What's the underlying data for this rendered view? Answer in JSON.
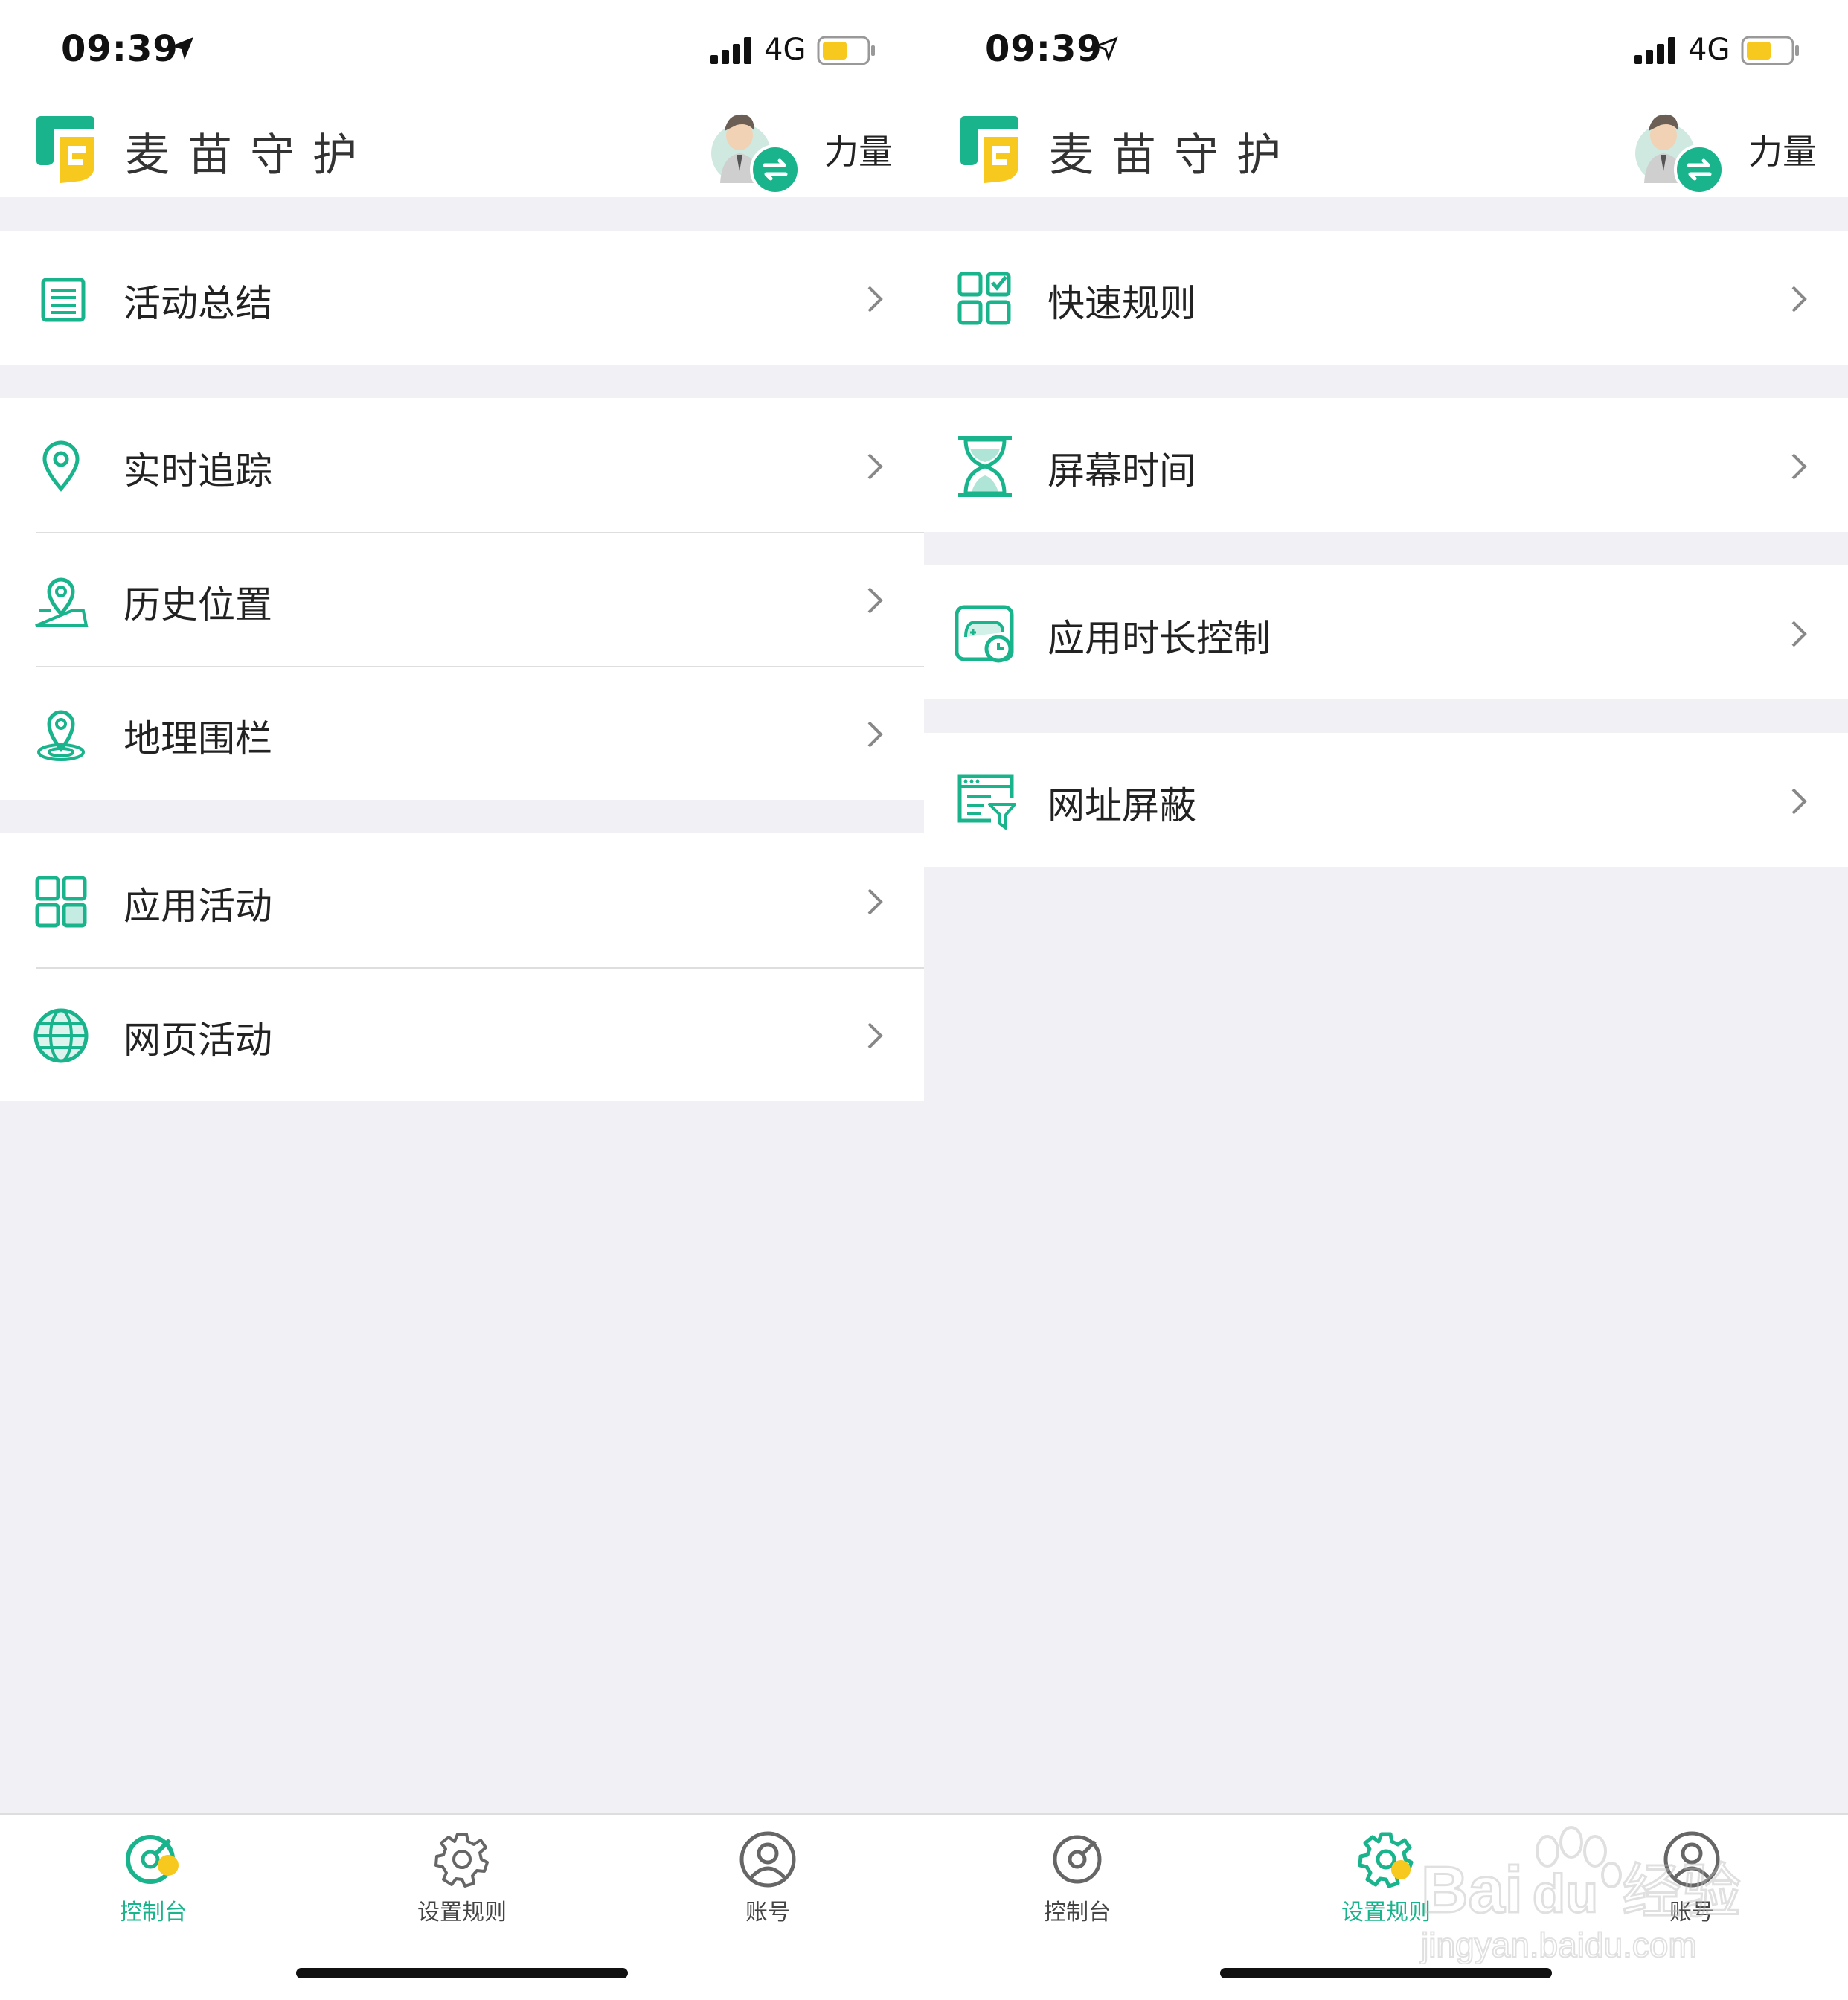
{
  "colors": {
    "accent": "#19b48c",
    "yellow": "#f7c81e",
    "text": "#222222",
    "bg": "#f0f0f5"
  },
  "left": {
    "status": {
      "time": "09:39",
      "network": "4G"
    },
    "header": {
      "title": "麦苗守护",
      "username": "力量"
    },
    "groups": [
      [
        {
          "icon": "list-doc-icon",
          "label": "活动总结"
        }
      ],
      [
        {
          "icon": "location-pin-icon",
          "label": "实时追踪"
        },
        {
          "icon": "map-pin-history-icon",
          "label": "历史位置"
        },
        {
          "icon": "geofence-icon",
          "label": "地理围栏"
        }
      ],
      [
        {
          "icon": "app-grid-icon",
          "label": "应用活动"
        },
        {
          "icon": "globe-icon",
          "label": "网页活动"
        }
      ]
    ],
    "tabs": [
      {
        "icon": "dashboard-icon",
        "label": "控制台",
        "active": true
      },
      {
        "icon": "gear-icon",
        "label": "设置规则",
        "active": false
      },
      {
        "icon": "user-icon",
        "label": "账号",
        "active": false
      }
    ]
  },
  "right": {
    "status": {
      "time": "09:39",
      "network": "4G"
    },
    "header": {
      "title": "麦苗守护",
      "username": "力量"
    },
    "groups": [
      [
        {
          "icon": "quick-rules-icon",
          "label": "快速规则"
        }
      ],
      [
        {
          "icon": "hourglass-icon",
          "label": "屏幕时间"
        }
      ],
      [
        {
          "icon": "game-clock-icon",
          "label": "应用时长控制"
        }
      ],
      [
        {
          "icon": "web-filter-icon",
          "label": "网址屏蔽"
        }
      ]
    ],
    "tabs": [
      {
        "icon": "dashboard-icon",
        "label": "控制台",
        "active": false
      },
      {
        "icon": "gear-icon",
        "label": "设置规则",
        "active": true
      },
      {
        "icon": "user-icon",
        "label": "账号",
        "active": false
      }
    ]
  },
  "watermark": {
    "brand": "Bai du 经验",
    "url": "jingyan.baidu.com"
  }
}
